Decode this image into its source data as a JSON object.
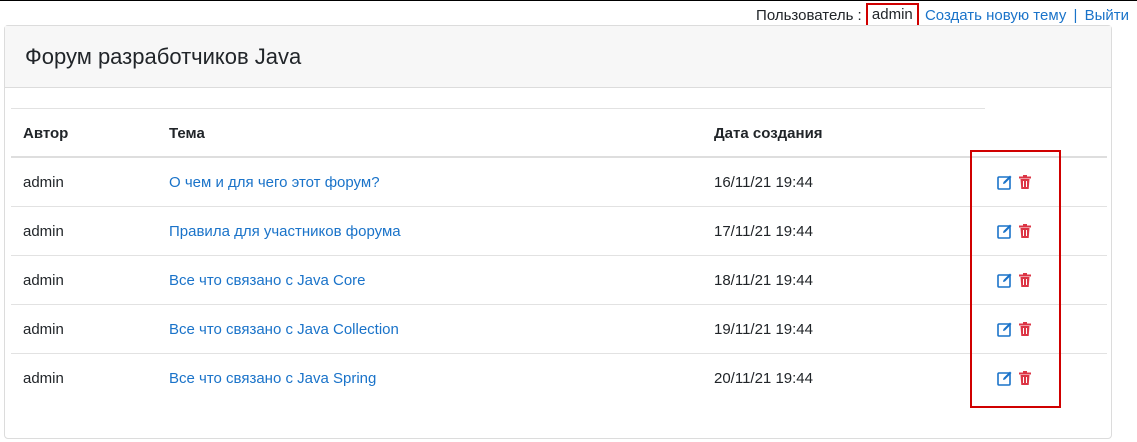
{
  "userbar": {
    "label": "Пользователь :",
    "username": "admin",
    "create_link": "Создать новую тему",
    "separator": "|",
    "logout_link": "Выйти"
  },
  "forum": {
    "title": "Форум разработчиков Java"
  },
  "table": {
    "headers": {
      "author": "Автор",
      "topic": "Тема",
      "date": "Дата создания"
    },
    "rows": [
      {
        "author": "admin",
        "topic": "О чем и для чего этот форум?",
        "date": "16/11/21 19:44"
      },
      {
        "author": "admin",
        "topic": "Правила для участников форума",
        "date": "17/11/21 19:44"
      },
      {
        "author": "admin",
        "topic": "Все что связано с Java Core",
        "date": "18/11/21 19:44"
      },
      {
        "author": "admin",
        "topic": "Все что связано с Java Collection",
        "date": "19/11/21 19:44"
      },
      {
        "author": "admin",
        "topic": "Все что связано с Java Spring",
        "date": "20/11/21 19:44"
      }
    ]
  },
  "icons": {
    "edit": "edit-icon",
    "delete": "trash-icon"
  },
  "colors": {
    "link": "#1a73c9",
    "delete": "#dc3545",
    "highlight": "#d00000"
  }
}
